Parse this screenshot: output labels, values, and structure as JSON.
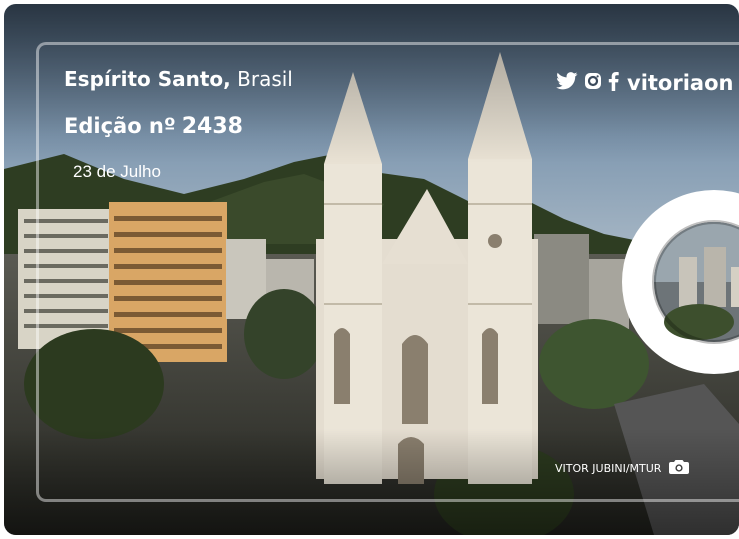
{
  "header": {
    "location_state": "Espírito Santo,",
    "location_country": " Brasil",
    "edition_label": "Edição nº",
    "edition_number": "2438",
    "date": "23 de Julho"
  },
  "social": {
    "icons": [
      "twitter-icon",
      "instagram-icon",
      "facebook-icon"
    ],
    "handle": "vitoriaon"
  },
  "photo": {
    "credit": "VITOR JUBINI/MTUR",
    "credit_icon": "camera-icon"
  },
  "colors": {
    "sky_top": "#7f98b0",
    "mountain": "#2e3d22",
    "cathedral": "#e4ddd0",
    "text": "#ffffff"
  }
}
